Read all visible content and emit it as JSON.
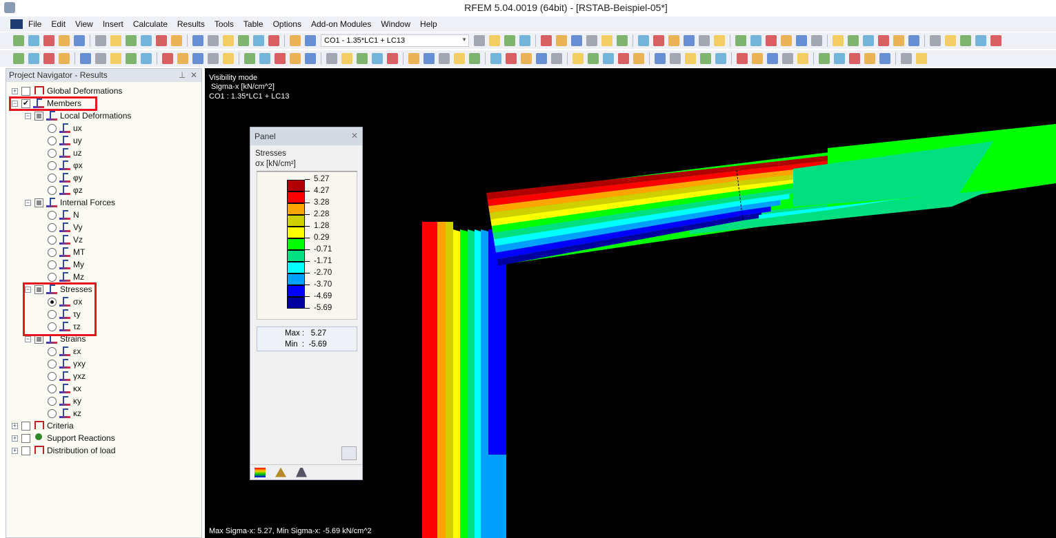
{
  "window": {
    "title": "RFEM 5.04.0019 (64bit) - [RSTAB-Beispiel-05*]"
  },
  "menu": [
    "File",
    "Edit",
    "View",
    "Insert",
    "Calculate",
    "Results",
    "Tools",
    "Table",
    "Options",
    "Add-on Modules",
    "Window",
    "Help"
  ],
  "toolbar": {
    "load_combo": "CO1 - 1.35*LC1 + LC13"
  },
  "navigator": {
    "title": "Project Navigator - Results",
    "items": [
      {
        "label": "Global Deformations",
        "level": 0,
        "type": "check",
        "expander": "+",
        "icon": "gd"
      },
      {
        "label": "Members",
        "level": 0,
        "type": "check",
        "checked": true,
        "expander": "-",
        "icon": "member"
      },
      {
        "label": "Local Deformations",
        "level": 1,
        "type": "partial",
        "expander": "-",
        "icon": "member"
      },
      {
        "label": "ux",
        "level": 2,
        "type": "radio",
        "icon": "member"
      },
      {
        "label": "uy",
        "level": 2,
        "type": "radio",
        "icon": "member"
      },
      {
        "label": "uz",
        "level": 2,
        "type": "radio",
        "icon": "member"
      },
      {
        "label": "φx",
        "level": 2,
        "type": "radio",
        "icon": "member"
      },
      {
        "label": "φy",
        "level": 2,
        "type": "radio",
        "icon": "member"
      },
      {
        "label": "φz",
        "level": 2,
        "type": "radio",
        "icon": "member"
      },
      {
        "label": "Internal Forces",
        "level": 1,
        "type": "partial",
        "expander": "-",
        "icon": "member"
      },
      {
        "label": "N",
        "level": 2,
        "type": "radio",
        "icon": "member"
      },
      {
        "label": "Vy",
        "level": 2,
        "type": "radio",
        "icon": "member"
      },
      {
        "label": "Vz",
        "level": 2,
        "type": "radio",
        "icon": "member"
      },
      {
        "label": "MT",
        "level": 2,
        "type": "radio",
        "icon": "member"
      },
      {
        "label": "My",
        "level": 2,
        "type": "radio",
        "icon": "member"
      },
      {
        "label": "Mz",
        "level": 2,
        "type": "radio",
        "icon": "member"
      },
      {
        "label": "Stresses",
        "level": 1,
        "type": "partial",
        "expander": "-",
        "icon": "member"
      },
      {
        "label": "σx",
        "level": 2,
        "type": "radio",
        "selected": true,
        "icon": "member"
      },
      {
        "label": "τy",
        "level": 2,
        "type": "radio",
        "icon": "member"
      },
      {
        "label": "τz",
        "level": 2,
        "type": "radio",
        "icon": "member"
      },
      {
        "label": "Strains",
        "level": 1,
        "type": "partial",
        "expander": "-",
        "icon": "member"
      },
      {
        "label": "εx",
        "level": 2,
        "type": "radio",
        "icon": "member"
      },
      {
        "label": "γxy",
        "level": 2,
        "type": "radio",
        "icon": "member"
      },
      {
        "label": "γxz",
        "level": 2,
        "type": "radio",
        "icon": "member"
      },
      {
        "label": "κx",
        "level": 2,
        "type": "radio",
        "icon": "member"
      },
      {
        "label": "κy",
        "level": 2,
        "type": "radio",
        "icon": "member"
      },
      {
        "label": "κz",
        "level": 2,
        "type": "radio",
        "icon": "member"
      },
      {
        "label": "Criteria",
        "level": 0,
        "type": "check",
        "expander": "+",
        "icon": "gd"
      },
      {
        "label": "Support Reactions",
        "level": 0,
        "type": "check",
        "expander": "+",
        "icon": "sr"
      },
      {
        "label": "Distribution of load",
        "level": 0,
        "type": "check",
        "expander": "+",
        "icon": "gd"
      }
    ]
  },
  "view": {
    "info_lines": [
      "Visibility mode",
      "Sigma-x [kN/cm^2]",
      "CO1 : 1.35*LC1 + LC13"
    ],
    "status": "Max Sigma-x: 5.27, Min Sigma-x: -5.69 kN/cm^2"
  },
  "panel": {
    "title": "Panel",
    "heading": "Stresses",
    "unit": "σx [kN/cm²]",
    "scale_values": [
      "5.27",
      "4.27",
      "3.28",
      "2.28",
      "1.28",
      "0.29",
      "-0.71",
      "-1.71",
      "-2.70",
      "-3.70",
      "-4.69",
      "-5.69"
    ],
    "band_colors": [
      "#b00000",
      "#ff0000",
      "#ffa500",
      "#d0d000",
      "#ffff00",
      "#00ff00",
      "#00e080",
      "#00ffff",
      "#00a0ff",
      "#0000ff",
      "#0000a0"
    ],
    "max_label": "Max",
    "max": "5.27",
    "min_label": "Min",
    "min": "-5.69"
  }
}
